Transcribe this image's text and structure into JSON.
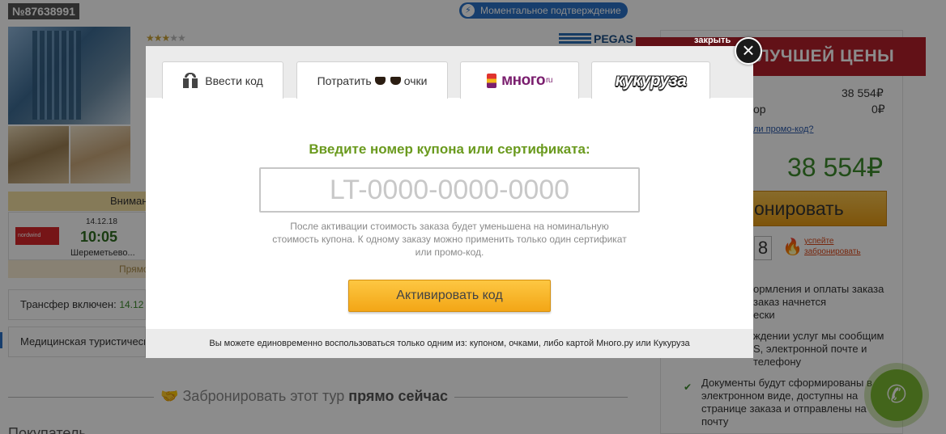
{
  "page": {
    "order_number": "№87638991",
    "instant_confirm": "Моментальное подтверждение",
    "stars_on": "★★★",
    "stars_off": "★★",
    "operator": "PEGAS",
    "attention": "Вниман",
    "flight": {
      "airline_logo": "nordwind",
      "date": "14.12.18",
      "time": "10:05",
      "airport": "Шереметьево..."
    },
    "beige_row": "Прямо",
    "transfer_label": "Трансфер включен:",
    "transfer_value": "14.12 А",
    "medical": "Медицинская туристическ",
    "book_now_prefix": "Забронировать этот тур",
    "book_now_bold": "прямо сейчас",
    "buyers": "Покупатель"
  },
  "sidebar": {
    "close_label": "закрыть",
    "ribbon": "ЛУЧШЕЙ ЦЕНЫ",
    "price_1": "38 554₽",
    "label_2": "ор",
    "price_2": "0₽",
    "promo_link": "ли промо-код?",
    "total": "38 554₽",
    "book_button": "онировать",
    "digit": "8",
    "hurry": "успейте\nзабронировать",
    "info_1": "ормления и оплаты заказа\nзаказ начнется\nески",
    "info_2": "ждении услуг мы сообщим\nS, электронной почте и\nтелефону",
    "info_3": "Документы будут сформированы в\nэлектронном виде, доступны на\nстранице заказа и отправлены на\nпочту"
  },
  "modal": {
    "tabs": [
      {
        "label": "Ввести код",
        "active": true
      },
      {
        "label_before": "Потратить",
        "label_after": "очки",
        "active": false
      },
      {
        "label": "много",
        "sup": "ru",
        "active": false
      },
      {
        "label": "кукуруза",
        "active": false
      }
    ],
    "heading": "Введите номер купона или сертификата:",
    "input_placeholder": "LT-0000-0000-0000",
    "hint": "После активации стоимость заказа будет уменьшена на номинальную стоимость купона. К одному заказу можно применить только один сертификат или промо-код.",
    "activate_button": "Активировать код",
    "footer_note": "Вы можете единовременно воспользоваться только одним из: купоном, очками, либо картой Много.ру или Кукуруза",
    "close_symbol": "×"
  },
  "colors": {
    "heading_green": "#6a9a1e",
    "button_orange": "#f3a616",
    "ribbon_red": "#b3202a",
    "price_green": "#3c8a2c"
  }
}
